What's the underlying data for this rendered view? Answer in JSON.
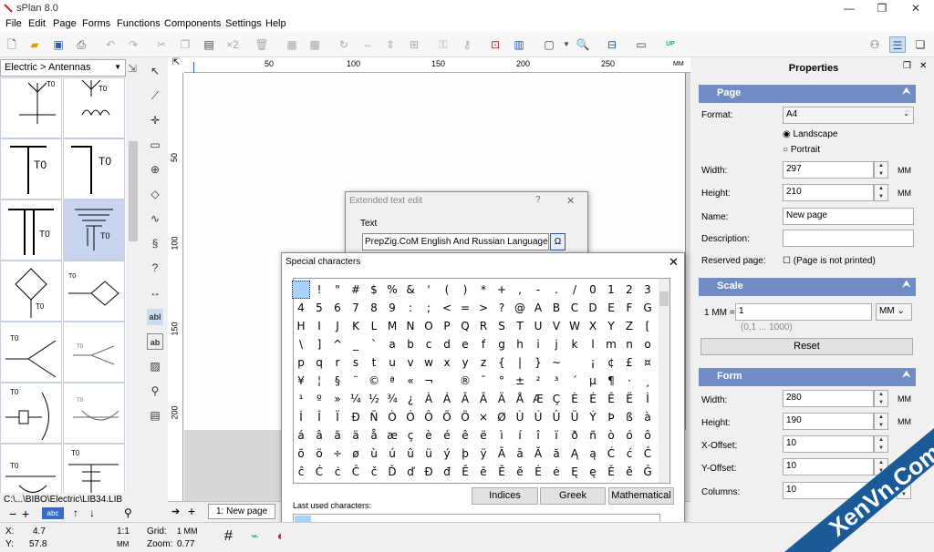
{
  "window": {
    "title": "sPlan 8.0",
    "min": "—",
    "max": "❐",
    "close": "✕"
  },
  "menu": [
    "File",
    "Edit",
    "Page",
    "Forms",
    "Functions",
    "Components",
    "Settings",
    "Help"
  ],
  "library": {
    "category": "Electric > Antennas",
    "path": "C:\\...\\BIBO\\Electric\\LIB34.LIB",
    "labels": {
      "t0": "T0"
    },
    "search_text": "abc"
  },
  "ruler": {
    "h": [
      "50",
      "100",
      "150",
      "200",
      "250",
      "MM"
    ],
    "v": [
      "50",
      "100",
      "150",
      "200"
    ]
  },
  "page_tab": "1: New page",
  "properties": {
    "title": "Properties",
    "page": {
      "header": "Page",
      "format_label": "Format:",
      "format_value": "A4",
      "landscape": "Landscape",
      "portrait": "Portrait",
      "width_label": "Width:",
      "width_value": "297",
      "height_label": "Height:",
      "height_value": "210",
      "unit": "MM",
      "name_label": "Name:",
      "name_value": "New page",
      "description_label": "Description:",
      "description_value": "",
      "reserved_label": "Reserved page:",
      "reserved_text": "(Page is not printed)"
    },
    "scale": {
      "header": "Scale",
      "label": "1 MM =",
      "value": "1",
      "unit": "MM",
      "hint": "(0,1 ... 1000)",
      "reset": "Reset"
    },
    "form": {
      "header": "Form",
      "width_label": "Width:",
      "width_value": "280",
      "height_label": "Height:",
      "height_value": "190",
      "xoff_label": "X-Offset:",
      "xoff_value": "10",
      "yoff_label": "Y-Offset:",
      "yoff_value": "10",
      "cols_label": "Columns:",
      "cols_value": "10",
      "unit": "MM"
    }
  },
  "ext_dialog": {
    "title": "Extended text edit",
    "help": "?",
    "close": "✕",
    "text_label": "Text",
    "text_value": "PrepZig.CoM English And Russian Language",
    "omega": "Ω"
  },
  "special_dialog": {
    "title": "Special characters",
    "close": "✕",
    "rows": [
      " !\"#$%&'()*+,-./0123",
      "456789:;<=>?@ABCDEFG",
      "HIJKLMNOPQRSTUVWXYZ[",
      "\\]^_`abcdefghijklmno",
      "pqrstuvwxyz{|}~ ¡¢£¤",
      "¥¦§¨©ª«¬­®¯°±²³´µ¶·¸",
      "¹º»¼½¾¿ÀÁÂÃÄÅÆÇÈÉÊËÌ",
      "ÍÎÏÐÑÒÓÔÕÖ×ØÙÚÛÜÝÞßà",
      "áâãäåæçèéêëìíîïðñòóô",
      "õö÷øùúûüýþÿĀāĂăĄąĆćĈ",
      "ĉĊċČčĎďĐđĒēĔĕĖėĘęĚěĜ"
    ],
    "last_used_label": "Last used characters:",
    "buttons": [
      "Indices",
      "Greek",
      "Mathematical"
    ]
  },
  "status": {
    "x_label": "X:",
    "x_value": "4.7",
    "y_label": "Y:",
    "y_value": "57.8",
    "scale": "1:1",
    "unit": "MM",
    "grid_label": "Grid:",
    "grid_value": "1 MM",
    "zoom_label": "Zoom:",
    "zoom_value": "0.77"
  },
  "watermark": "XenVn.Com",
  "colors": {
    "header": "#6f8cc4",
    "selected": "#c8d4f0",
    "accent": "#2a59a8"
  }
}
